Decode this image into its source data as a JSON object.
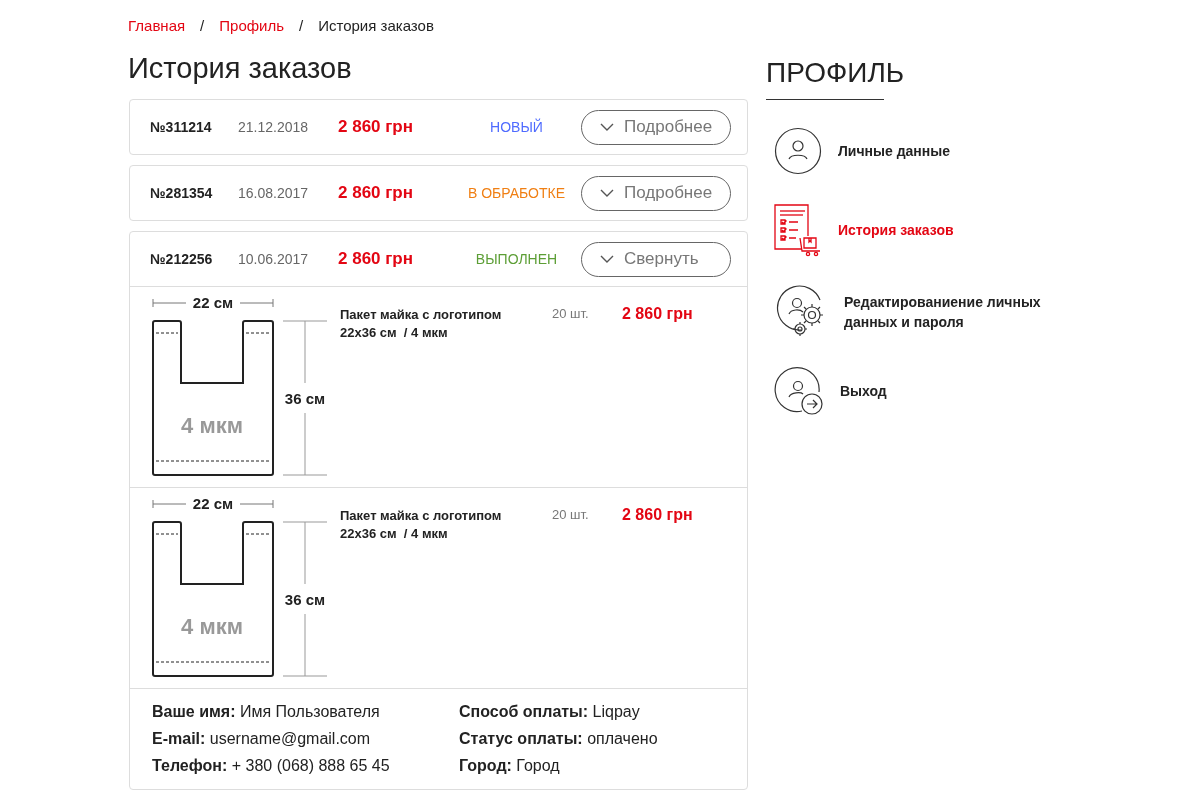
{
  "breadcrumbs": [
    {
      "label": "Главная",
      "kind": "link"
    },
    {
      "label": "Профиль",
      "kind": "link",
      "separator": "/"
    },
    {
      "label": "История заказов",
      "kind": "current",
      "separator": "/"
    }
  ],
  "title": "История заказов",
  "orders": [
    {
      "number": "№311214",
      "date": "21.12.2018",
      "total": "2 860 грн",
      "status": "НОВЫЙ",
      "color": "#4f6bff",
      "button": "Подробнее",
      "expanded": false
    },
    {
      "number": "№281354",
      "date": "16.08.2017",
      "total": "2 860 грн",
      "status": "В ОБРАБОТКЕ",
      "color": "#f07f13",
      "button": "Подробнее",
      "expanded": false
    },
    {
      "number": "№212256",
      "date": "10.06.2017",
      "total": "2 860 грн",
      "status": "ВЫПОЛНЕН",
      "color": "#5c9e35",
      "button": "Свернуть",
      "expanded": true,
      "items": [
        {
          "width": "22 см",
          "height": "36 см",
          "thickness": "4 мкм",
          "name": "Пакет майка с логотипом",
          "spec": "22x36 см  / 4 мкм",
          "quantity": "20 шт.",
          "price": "2 860 грн"
        },
        {
          "width": "22 см",
          "height": "36 см",
          "thickness": "4 мкм",
          "name": "Пакет майка с логотипом",
          "spec": "22x36 см  / 4 мкм",
          "quantity": "20 шт.",
          "price": "2 860 грн"
        }
      ],
      "details": [
        {
          "text": "**Ваше имя:** Имя Пользователя"
        },
        {
          "text": "**Способ оплаты:** Liqpay"
        },
        {
          "text": "**E-mail:** username@gmail.com"
        },
        {
          "text": "**Статус оплаты:** оплачено"
        },
        {
          "text": "**Телефон:** + 380 (068) 888 65 45"
        },
        {
          "text": "**Город:** Город"
        }
      ]
    }
  ],
  "sidebar": {
    "title": "ПРОФИЛЬ",
    "items": [
      {
        "label": "Личные данные",
        "kind": "person",
        "selected": false
      },
      {
        "label": "История заказов",
        "kind": "orders",
        "selected": true
      },
      {
        "label": "Редактированиение личных данных и пароля",
        "kind": "settings",
        "selected": false
      },
      {
        "label": "Выход",
        "kind": "exit",
        "selected": false
      }
    ]
  }
}
